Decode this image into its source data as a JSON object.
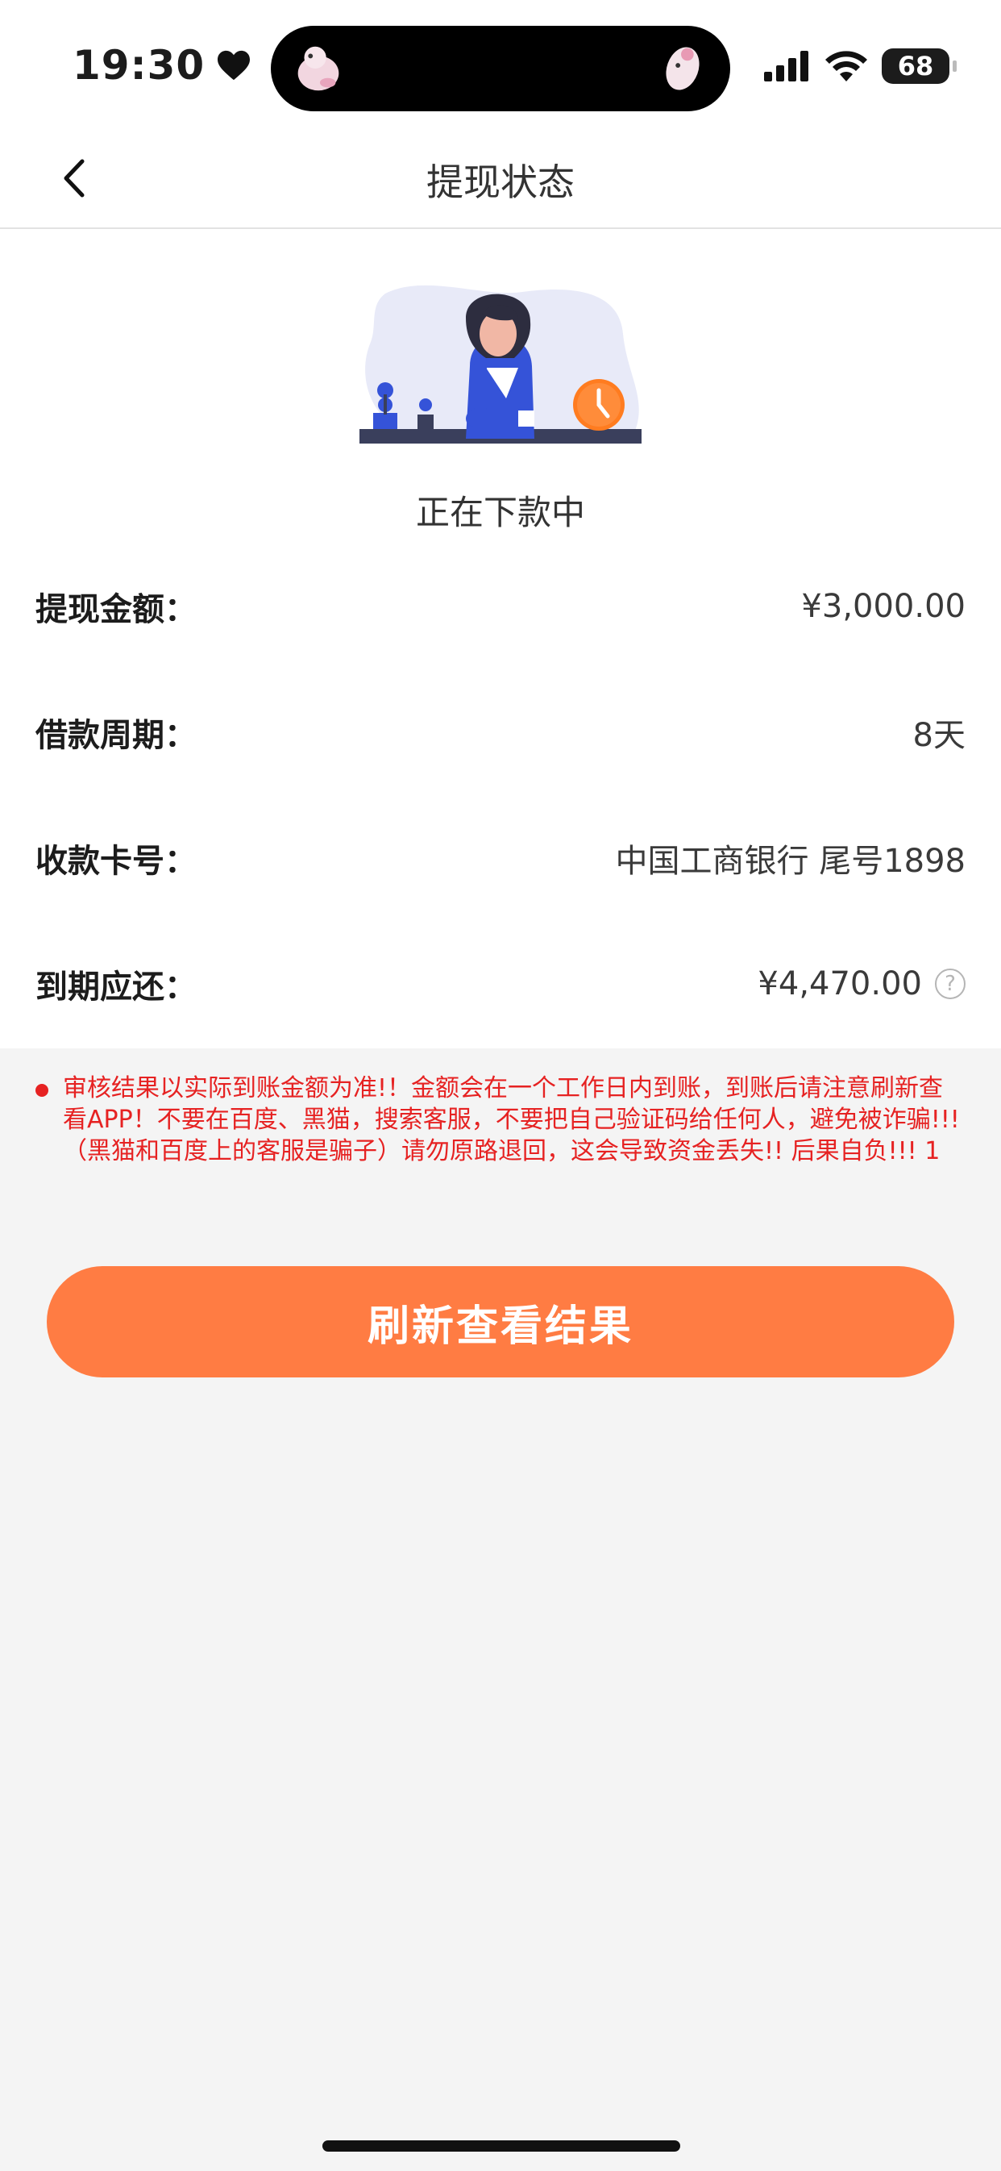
{
  "status_bar": {
    "time": "19:30",
    "battery": "68",
    "icons": [
      "heart-icon",
      "signal-icon",
      "wifi-icon",
      "battery-icon"
    ]
  },
  "nav": {
    "title": "提现状态",
    "back_icon": "chevron-left-icon"
  },
  "status": {
    "text": "正在下款中"
  },
  "details": [
    {
      "label": "提现金额：",
      "value": "¥3,000.00"
    },
    {
      "label": "借款周期：",
      "value": "8天"
    },
    {
      "label": "收款卡号：",
      "value": "中国工商银行 尾号1898"
    },
    {
      "label": "到期应还：",
      "value": "¥4,470.00",
      "help_icon": "question-circle-icon"
    }
  ],
  "notice": {
    "text": "审核结果以实际到账金额为准!！金额会在一个工作日内到账，到账后请注意刷新查看APP！不要在百度、黑猫，搜索客服，不要把自己验证码给任何人，避免被诈骗!!!（黑猫和百度上的客服是骗子）请勿原路退回，这会导致资金丢失!!  后果自负!!!    1",
    "color": "#e62222"
  },
  "button": {
    "label": "刷新查看结果",
    "color": "#ff7c43"
  }
}
